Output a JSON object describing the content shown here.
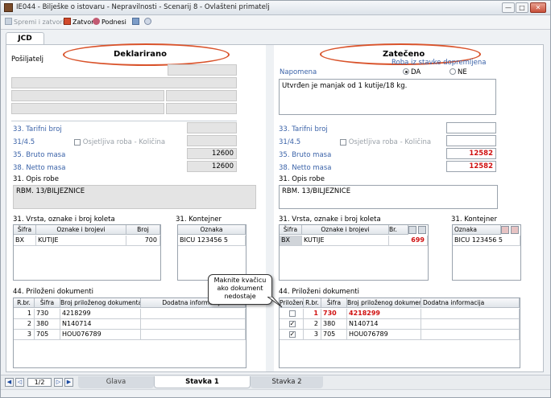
{
  "window": {
    "title": "IE044 - Bilješke o istovaru - Nepravilnosti - Scenarij 8 - Ovlašteni primatelj"
  },
  "window_controls": {
    "minimize": "—",
    "maximize": "□",
    "close": "✕"
  },
  "toolbar": {
    "save_close": "Spremi i zatvori",
    "close": "Zatvori",
    "submit": "Podnesi"
  },
  "tab": {
    "label": "JCD"
  },
  "left": {
    "heading": "Deklarirano",
    "sender_label": "Pošiljatelj",
    "tariff_label": "33. Tarifni broj",
    "code_label": "31/4.5",
    "sensitive_label": "Osjetljiva roba - Količina",
    "gross_label": "35. Bruto masa",
    "gross_value": "12600",
    "net_label": "38. Netto masa",
    "net_value": "12600",
    "desc_label": "31. Opis robe",
    "desc_value": "RBM. 13/BILJEZNICE",
    "packages_label": "31. Vrsta, oznake i broj koleta",
    "packages": {
      "columns": [
        "Šifra",
        "Oznake i brojevi",
        "Broj"
      ],
      "rows": [
        [
          "BX",
          "KUTIJE",
          "700"
        ]
      ]
    },
    "container_label": "31. Kontejner",
    "container": {
      "columns": [
        "Oznaka"
      ],
      "rows": [
        [
          "BICU 123456 5"
        ]
      ]
    },
    "docs_label": "44. Priloženi dokumenti",
    "docs": {
      "columns": [
        "R.br.",
        "Šifra",
        "Broj priloženog dokumenta",
        "Dodatna informacija"
      ],
      "rows": [
        [
          "1",
          "730",
          "4218299",
          ""
        ],
        [
          "2",
          "380",
          "N140714",
          ""
        ],
        [
          "3",
          "705",
          "HOU076789",
          ""
        ]
      ]
    }
  },
  "right": {
    "heading": "Zatečeno",
    "note_label": "Napomena",
    "shipped_label": "Roba iz stavke dopremljena",
    "yes_label": "DA",
    "no_label": "NE",
    "note_value": "Utvrđen je manjak od 1 kutije/18 kg.",
    "tariff_label": "33. Tarifni broj",
    "code_label": "31/4.5",
    "sensitive_label": "Osjetljiva roba - Količina",
    "gross_label": "35. Bruto masa",
    "gross_value": "12582",
    "net_label": "38. Netto masa",
    "net_value": "12582",
    "desc_label": "31. Opis robe",
    "desc_value": "RBM. 13/BILJEZNICE",
    "packages_label": "31. Vrsta, oznake i broj koleta",
    "packages": {
      "columns": [
        "Šifra",
        "Oznake i brojevi",
        "Br."
      ],
      "rows": [
        [
          "BX",
          "KUTIJE",
          "699"
        ]
      ]
    },
    "container_label": "31. Kontejner",
    "container": {
      "columns": [
        "Oznaka"
      ],
      "rows": [
        [
          "BICU 123456 5"
        ]
      ]
    },
    "docs_label": "44. Priloženi dokumenti",
    "docs": {
      "columns": [
        "Priložen",
        "R.br.",
        "Šifra",
        "Broj priloženog dokumenta",
        "Dodatna informacija"
      ],
      "rows": [
        [
          "",
          "1",
          "730",
          "4218299",
          ""
        ],
        [
          "✓",
          "2",
          "380",
          "N140714",
          ""
        ],
        [
          "✓",
          "3",
          "705",
          "HOU076789",
          ""
        ]
      ]
    }
  },
  "callout": {
    "line1": "Maknite kvačicu",
    "line2": "ako dokument",
    "line3": "nedostaje"
  },
  "footer": {
    "page": "1/2",
    "tab_glava": "Glava",
    "tab_stavka1": "Stavka 1",
    "tab_stavka2": "Stavka 2"
  },
  "colors": {
    "accent_blue": "#3a62a8",
    "alert_red": "#d01010",
    "highlight": "#d9532b"
  }
}
